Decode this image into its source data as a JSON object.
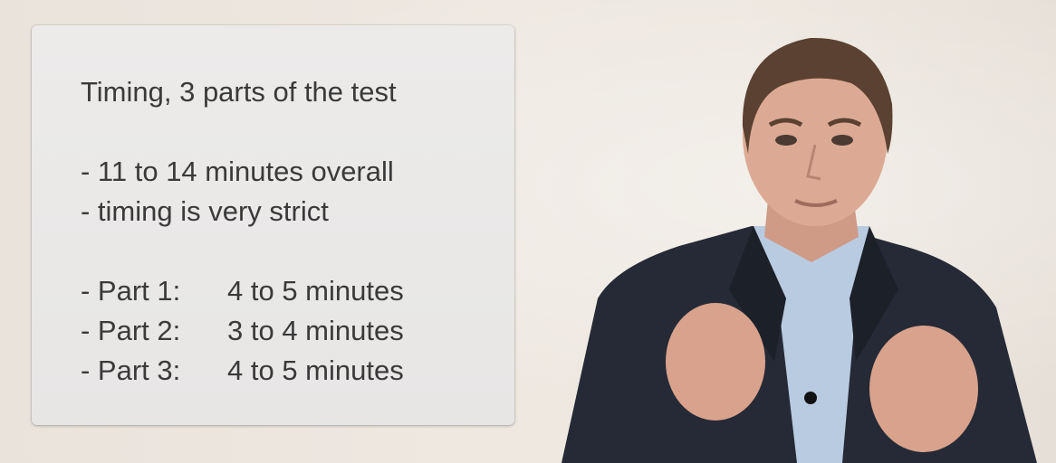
{
  "slide": {
    "title": "Timing, 3 parts of the test",
    "overview": [
      "- 11 to 14 minutes overall",
      "- timing is very strict"
    ],
    "parts": [
      {
        "label": "- Part 1:",
        "duration": "4 to 5 minutes"
      },
      {
        "label": "- Part 2:",
        "duration": "3 to 4 minutes"
      },
      {
        "label": "- Part 3:",
        "duration": "4 to 5 minutes"
      }
    ]
  },
  "colors": {
    "background": "#ece6df",
    "card": "#e9e8e7",
    "text": "#3a3a3a",
    "jacket": "#252a36",
    "shirt": "#b7c9dd",
    "skin": "#d9a58f",
    "hair": "#5a4030"
  },
  "presenter": {
    "icon": "presenter-figure-icon"
  }
}
